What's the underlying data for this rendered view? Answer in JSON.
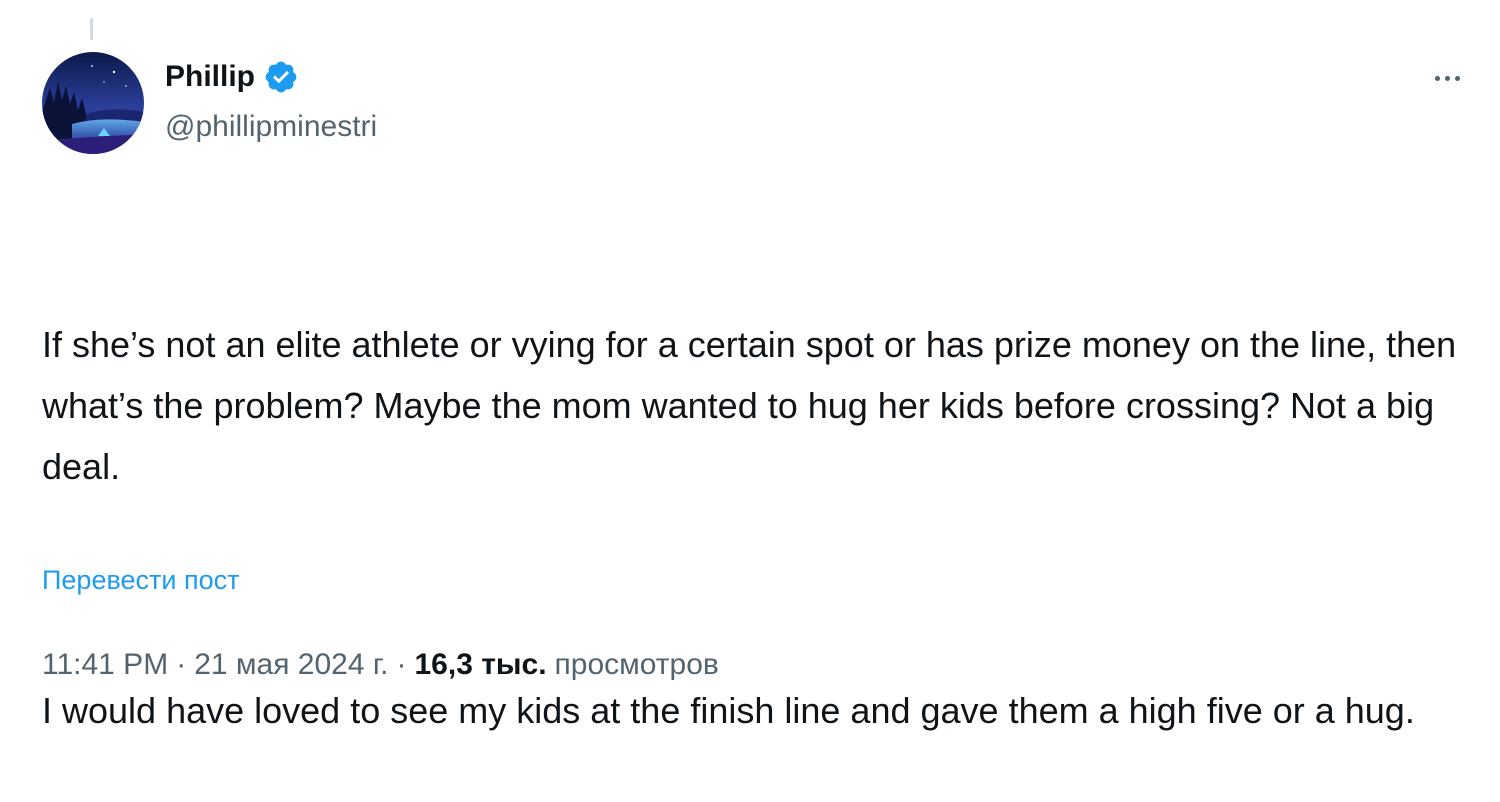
{
  "author": {
    "display_name": "Phillip",
    "handle": "@phillipminestri",
    "verified": true,
    "avatar_icon": "avatar-night-landscape",
    "verified_icon": "verified-badge-icon"
  },
  "tweet": {
    "paragraphs": [
      "If she’s not an elite athlete or vying for a certain spot or has prize money on the line, then what’s the problem? Maybe the mom wanted to hug her kids before crossing? Not a big deal.",
      "I would have loved to see my kids at the finish line and gave them a high five or a hug."
    ],
    "translate_label": "Перевести пост"
  },
  "meta": {
    "time": "11:41 PM",
    "date": "21 мая 2024 г.",
    "separator": "·",
    "views_count": "16,3 тыс.",
    "views_label": "просмотров"
  },
  "more_icon": "more-horizontal-icon",
  "colors": {
    "accent": "#1d9bf0",
    "text_primary": "#0f1419",
    "text_secondary": "#536471"
  }
}
